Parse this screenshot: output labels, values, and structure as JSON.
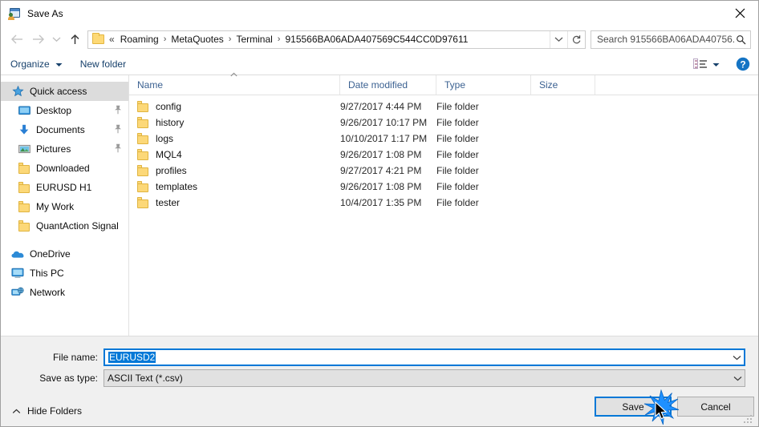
{
  "window": {
    "title": "Save As",
    "icon": "metatrader-save-icon",
    "close_label": "✕"
  },
  "nav": {
    "back_icon": "back-arrow-icon",
    "forward_icon": "forward-arrow-icon",
    "recent_icon": "chevron-down-icon",
    "up_icon": "up-arrow-icon",
    "refresh_icon": "refresh-icon",
    "breadcrumb_prefix": "«",
    "breadcrumbs": [
      "Roaming",
      "MetaQuotes",
      "Terminal",
      "915566BA06ADA407569C544CC0D97611"
    ],
    "separator": "›"
  },
  "search": {
    "placeholder": "Search 915566BA06ADA40756...",
    "icon": "search-icon"
  },
  "commandbar": {
    "organize_label": "Organize",
    "new_folder_label": "New folder",
    "view_icon": "view-details-icon",
    "help_icon": "help-icon",
    "help_label": "?"
  },
  "sidebar": {
    "items": [
      {
        "label": "Quick access",
        "icon": "star-icon",
        "selected": true,
        "indent": 0,
        "pinned": false
      },
      {
        "label": "Desktop",
        "icon": "desktop-icon",
        "selected": false,
        "indent": 1,
        "pinned": true
      },
      {
        "label": "Documents",
        "icon": "documents-download-icon",
        "selected": false,
        "indent": 1,
        "pinned": true
      },
      {
        "label": "Pictures",
        "icon": "pictures-icon",
        "selected": false,
        "indent": 1,
        "pinned": true
      },
      {
        "label": "Downloaded",
        "icon": "folder-icon",
        "selected": false,
        "indent": 1,
        "pinned": false
      },
      {
        "label": "EURUSD H1",
        "icon": "folder-icon",
        "selected": false,
        "indent": 1,
        "pinned": false
      },
      {
        "label": "My Work",
        "icon": "folder-icon",
        "selected": false,
        "indent": 1,
        "pinned": false
      },
      {
        "label": "QuantAction Signal",
        "icon": "folder-icon",
        "selected": false,
        "indent": 1,
        "pinned": false
      }
    ],
    "roots": [
      {
        "label": "OneDrive",
        "icon": "onedrive-cloud-icon"
      },
      {
        "label": "This PC",
        "icon": "this-pc-icon"
      },
      {
        "label": "Network",
        "icon": "network-icon"
      }
    ]
  },
  "filelist": {
    "columns": [
      "Name",
      "Date modified",
      "Type",
      "Size"
    ],
    "sort_column": "Name",
    "sort_direction": "ascending",
    "rows": [
      {
        "name": "config",
        "date": "9/27/2017 4:44 PM",
        "type": "File folder",
        "size": ""
      },
      {
        "name": "history",
        "date": "9/26/2017 10:17 PM",
        "type": "File folder",
        "size": ""
      },
      {
        "name": "logs",
        "date": "10/10/2017 1:17 PM",
        "type": "File folder",
        "size": ""
      },
      {
        "name": "MQL4",
        "date": "9/26/2017 1:08 PM",
        "type": "File folder",
        "size": ""
      },
      {
        "name": "profiles",
        "date": "9/27/2017 4:21 PM",
        "type": "File folder",
        "size": ""
      },
      {
        "name": "templates",
        "date": "9/26/2017 1:08 PM",
        "type": "File folder",
        "size": ""
      },
      {
        "name": "tester",
        "date": "10/4/2017 1:35 PM",
        "type": "File folder",
        "size": ""
      }
    ]
  },
  "footer": {
    "filename_label": "File name:",
    "filename_value": "EURUSD2",
    "filename_selected": true,
    "savetype_label": "Save as type:",
    "savetype_value": "ASCII Text (*.csv)",
    "hide_folders_label": "Hide Folders",
    "save_label": "Save",
    "cancel_label": "Cancel"
  },
  "colors": {
    "accent": "#0078d7",
    "folder": "#fcd878",
    "header_text": "#3b6191",
    "command_text": "#16406b"
  }
}
